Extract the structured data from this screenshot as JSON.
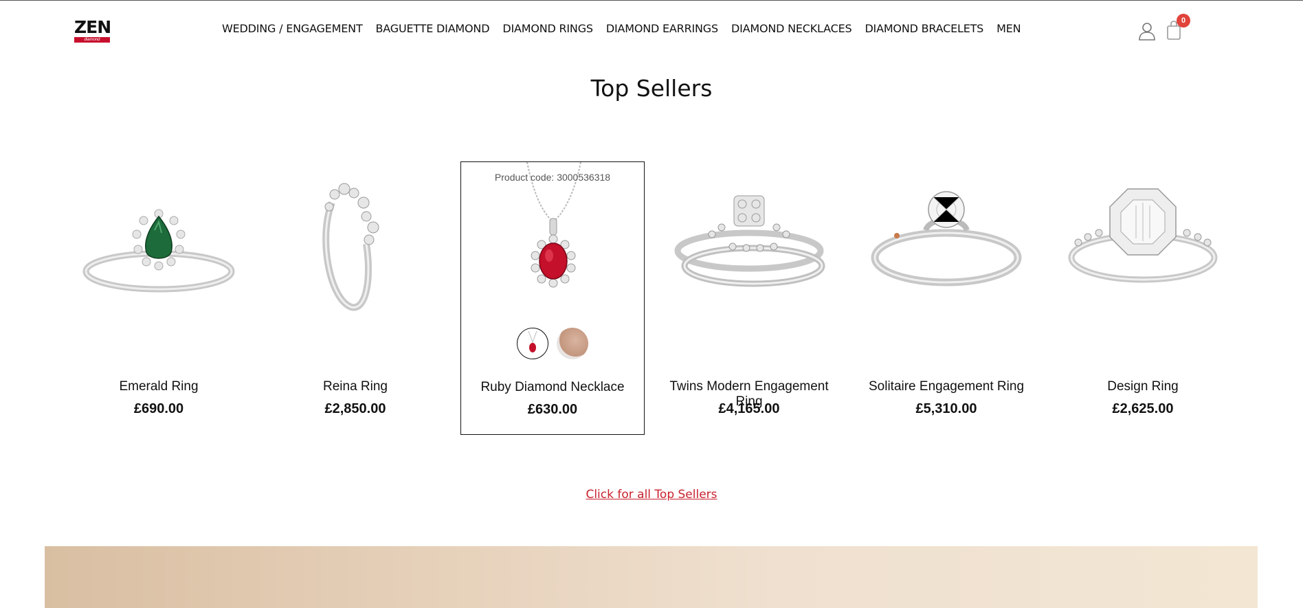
{
  "header": {
    "logo_text": "ZEN",
    "logo_sub": "diamond",
    "nav": [
      "WEDDING / ENGAGEMENT",
      "BAGUETTE DIAMOND",
      "DIAMOND RINGS",
      "DIAMOND EARRINGS",
      "DIAMOND NECKLACES",
      "DIAMOND BRACELETS",
      "MEN"
    ],
    "cart_count": "0"
  },
  "section": {
    "title": "Top Sellers",
    "link": "Click for all Top Sellers"
  },
  "products": [
    {
      "name": "Emerald Ring",
      "price": "£690.00",
      "icon": "emerald-ring-image"
    },
    {
      "name": "Reina Ring",
      "price": "£2,850.00",
      "icon": "reina-ring-image"
    },
    {
      "name": "Ruby Diamond Necklace",
      "price": "£630.00",
      "code": "Product code: 3000536318",
      "icon": "ruby-necklace-image"
    },
    {
      "name": "Twins Modern Engagement Ring",
      "price": "£4,165.00",
      "icon": "twins-ring-image"
    },
    {
      "name": "Solitaire Engagement Ring",
      "price": "£5,310.00",
      "icon": "solitaire-ring-image"
    },
    {
      "name": "Design Ring",
      "price": "£2,625.00",
      "icon": "design-ring-image"
    }
  ],
  "colors": {
    "accent": "#c8222e",
    "badge": "#e0433a",
    "emerald": "#1d6b3a",
    "ruby": "#c4102a"
  }
}
